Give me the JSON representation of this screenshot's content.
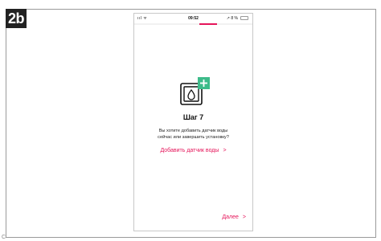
{
  "figure": {
    "badge_label": "2b",
    "corner_mark": "C"
  },
  "status_bar": {
    "signal": "ııl ᯤ",
    "time": "09:52",
    "right": "↗ 8 %"
  },
  "progress": {
    "value": 0.15,
    "start": 0.55,
    "color": "#e5155a"
  },
  "icons": {
    "device": "water-sensor-add-icon"
  },
  "content": {
    "title": "Шаг 7",
    "question_line1": "Вы хотите добавить датчик воды",
    "question_line2": "сейчас или завершить установку?",
    "add_sensor_label": "Добавить датчик воды",
    "add_sensor_chevron": ">",
    "next_label": "Далее",
    "next_chevron": ">"
  },
  "colors": {
    "accent": "#e5155a",
    "plus_green": "#3dbb8a"
  }
}
